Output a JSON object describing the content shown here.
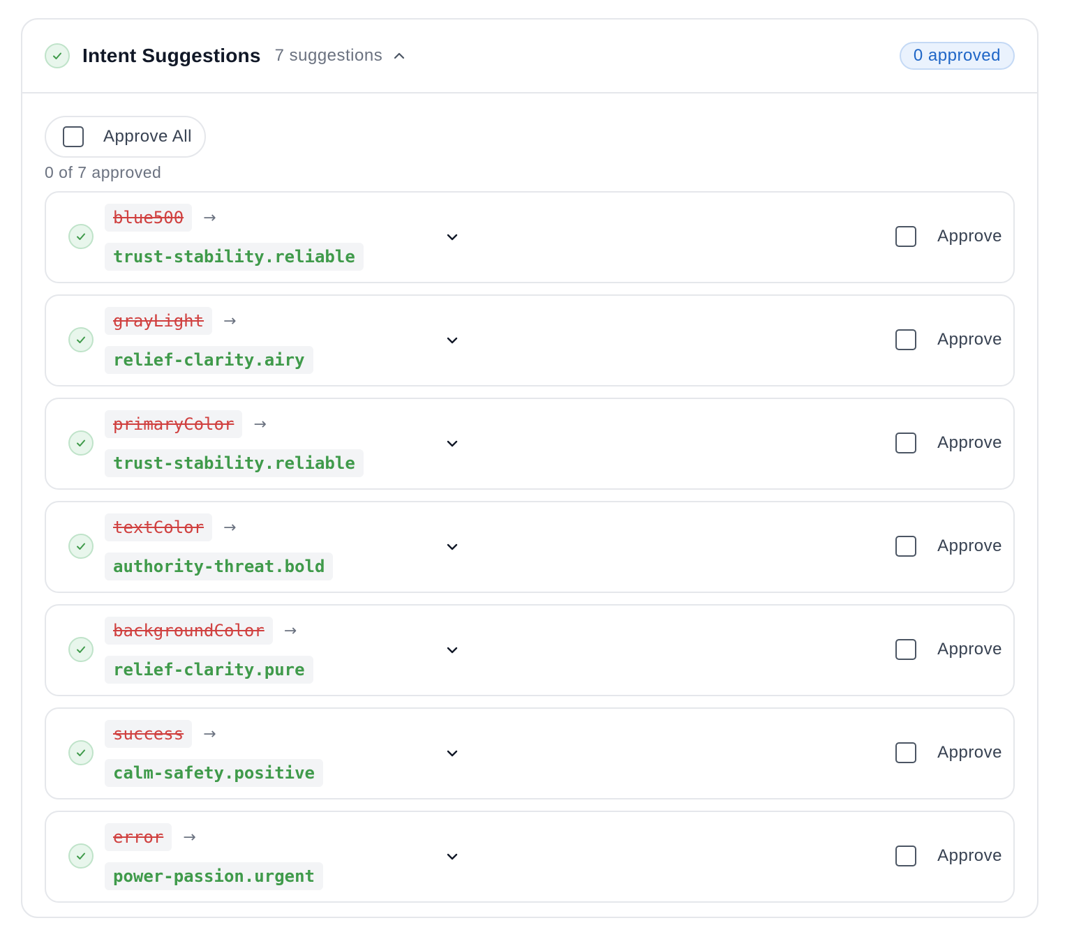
{
  "header": {
    "title": "Intent Suggestions",
    "count_text": "7 suggestions",
    "approved_badge": "0 approved"
  },
  "controls": {
    "approve_all_label": "Approve All",
    "summary": "0 of 7 approved"
  },
  "suggestions": [
    {
      "from": "blue500",
      "to": "trust-stability.reliable",
      "approve_label": "Approve",
      "approved": false
    },
    {
      "from": "grayLight",
      "to": "relief-clarity.airy",
      "approve_label": "Approve",
      "approved": false
    },
    {
      "from": "primaryColor",
      "to": "trust-stability.reliable",
      "approve_label": "Approve",
      "approved": false
    },
    {
      "from": "textColor",
      "to": "authority-threat.bold",
      "approve_label": "Approve",
      "approved": false
    },
    {
      "from": "backgroundColor",
      "to": "relief-clarity.pure",
      "approve_label": "Approve",
      "approved": false
    },
    {
      "from": "success",
      "to": "calm-safety.positive",
      "approve_label": "Approve",
      "approved": false
    },
    {
      "from": "error",
      "to": "power-passion.urgent",
      "approve_label": "Approve",
      "approved": false
    }
  ],
  "icons": {
    "status": "check-circle-icon",
    "collapse": "chevron-up-icon",
    "expand": "chevron-down-icon",
    "mapping": "arrow-right-icon"
  },
  "colors": {
    "success": "#3f9a4a",
    "removed": "#d0403f",
    "accent": "#1f66c7"
  }
}
